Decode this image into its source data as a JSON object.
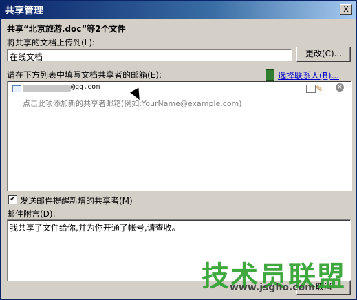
{
  "window": {
    "title": "共享管理",
    "close_label": "X"
  },
  "heading": "共享“北京旅游.doc”等2个文件",
  "upload": {
    "label": "将共享的文档上传到(L):",
    "value": "在线文档",
    "change_button": "更改(C)..."
  },
  "recipients": {
    "label": "请在下方列表中填写文档共享者的邮箱(E):",
    "select_contacts_link": "选择联系人(B)...",
    "entry_suffix": "@qq.com",
    "add_placeholder": "点击此项添加新的共享者邮箱(例如:YourName@example.com)"
  },
  "notify": {
    "label": "发送邮件提醒新增的共享者(M)",
    "checked": true,
    "check_glyph": "✔"
  },
  "message": {
    "label": "邮件附言(D):",
    "value": "我共享了文件给你,并为你开通了帐号,请查收。"
  },
  "footer": {
    "cancel_button": "取消"
  },
  "watermark": {
    "brand": "技术员联盟",
    "url": "www.jsgho.com"
  }
}
